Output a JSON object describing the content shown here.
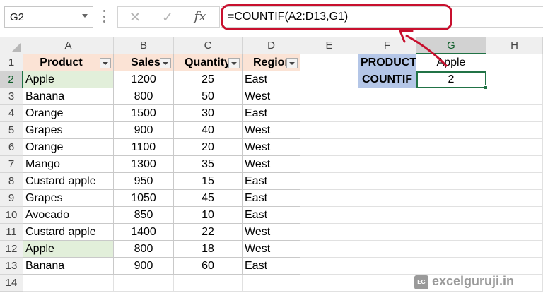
{
  "formula_bar": {
    "name_box": "G2",
    "cancel_glyph": "✕",
    "enter_glyph": "✓",
    "fx_label": "fx",
    "formula": "=COUNTIF(A2:D13,G1)"
  },
  "sheet": {
    "columns": [
      "A",
      "B",
      "C",
      "D",
      "E",
      "F",
      "G",
      "H"
    ],
    "rows": [
      "1",
      "2",
      "3",
      "4",
      "5",
      "6",
      "7",
      "8",
      "9",
      "10",
      "11",
      "12",
      "13",
      "14"
    ],
    "selected_column": "G",
    "selected_row": "2",
    "headers": [
      "Product",
      "Sales",
      "Quantity",
      "Region"
    ],
    "data": [
      [
        "Apple",
        "1200",
        "25",
        "East"
      ],
      [
        "Banana",
        "800",
        "50",
        "West"
      ],
      [
        "Orange",
        "1500",
        "30",
        "East"
      ],
      [
        "Grapes",
        "900",
        "40",
        "West"
      ],
      [
        "Orange",
        "1100",
        "20",
        "West"
      ],
      [
        "Mango",
        "1300",
        "35",
        "West"
      ],
      [
        "Custard apple",
        "950",
        "15",
        "East"
      ],
      [
        "Grapes",
        "1050",
        "45",
        "East"
      ],
      [
        "Avocado",
        "850",
        "10",
        "East"
      ],
      [
        "Custard apple",
        "1400",
        "22",
        "West"
      ],
      [
        "Apple",
        "800",
        "18",
        "West"
      ],
      [
        "Banana",
        "900",
        "60",
        "East"
      ]
    ],
    "lookup": {
      "label1": "PRODUCT",
      "value1": "Apple",
      "label2": "COUNTIF",
      "value2": "2"
    }
  },
  "colors": {
    "header_fill": "#fbe3d5",
    "match_fill": "#e2efda",
    "label_fill": "#b4c6e7",
    "annotation": "#c8102e",
    "selection": "#217346"
  },
  "icons": [
    "chevron-down-icon",
    "cancel-icon",
    "enter-icon",
    "fx-icon",
    "filter-dropdown-icon",
    "excelguruji-logo-icon"
  ],
  "watermark": {
    "logo_text": "EG",
    "text": "excelguruji.in"
  }
}
